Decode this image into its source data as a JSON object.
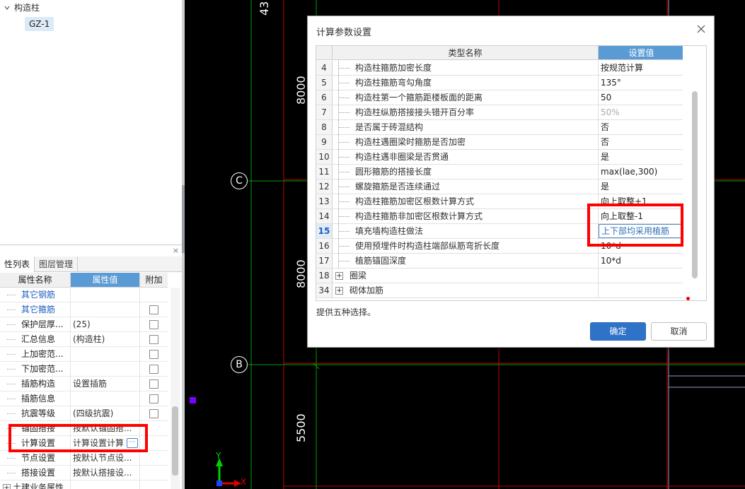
{
  "tree": {
    "root_label": "构造柱",
    "leaf_label": "GZ-1"
  },
  "prop_panel": {
    "close_glyph": "×",
    "tabs": [
      "性列表",
      "图层管理"
    ],
    "headers": {
      "name": "属性名称",
      "value": "属性值",
      "extra": "附加"
    },
    "rows": [
      {
        "name": "其它钢筋",
        "value": "",
        "blue": true,
        "checkbox": false
      },
      {
        "name": "其它箍筋",
        "value": "",
        "blue": true,
        "checkbox": true
      },
      {
        "name": "保护层厚...",
        "value": "(25)",
        "blue": false,
        "checkbox": true
      },
      {
        "name": "汇总信息",
        "value": "(构造柱)",
        "blue": false,
        "checkbox": true
      },
      {
        "name": "上加密范...",
        "value": "",
        "blue": false,
        "checkbox": true
      },
      {
        "name": "下加密范...",
        "value": "",
        "blue": false,
        "checkbox": true
      },
      {
        "name": "插筋构造",
        "value": "设置插筋",
        "blue": false,
        "checkbox": true
      },
      {
        "name": "插筋信息",
        "value": "",
        "blue": false,
        "checkbox": true
      },
      {
        "name": "抗震等级",
        "value": "(四级抗震)",
        "blue": false,
        "checkbox": true
      },
      {
        "name": "锚固搭接",
        "value": "按默认锚固搭...",
        "blue": false,
        "checkbox": false
      },
      {
        "name": "计算设置",
        "value": "计算设置计算",
        "blue": false,
        "checkbox": false,
        "ellipsis": true
      },
      {
        "name": "节点设置",
        "value": "按默认节点设...",
        "blue": false,
        "checkbox": false
      },
      {
        "name": "搭接设置",
        "value": "按默认搭接设...",
        "blue": false,
        "checkbox": false
      },
      {
        "name": "土建业务属性",
        "value": "",
        "blue": false,
        "checkbox": false,
        "group": true
      }
    ]
  },
  "canvas": {
    "dimensions": [
      "43",
      "8000",
      "8000",
      "5500"
    ],
    "axis_bubbles": [
      "C",
      "B"
    ],
    "ucs": {
      "y": "Y",
      "x": "X"
    }
  },
  "dialog": {
    "title": "计算参数设置",
    "columns": {
      "name": "类型名称",
      "value": "设置值"
    },
    "rows": [
      {
        "num": "4",
        "name": "构造柱箍筋加密长度",
        "value": "按规范计算"
      },
      {
        "num": "5",
        "name": "构造柱箍筋弯勾角度",
        "value": "135°"
      },
      {
        "num": "6",
        "name": "构造柱第一个箍筋距楼板面的距离",
        "value": "50"
      },
      {
        "num": "7",
        "name": "构造柱纵筋搭接接头错开百分率",
        "value": "50%",
        "gray": true
      },
      {
        "num": "8",
        "name": "是否属于砖混结构",
        "value": "否"
      },
      {
        "num": "9",
        "name": "构造柱遇圈梁时箍筋是否加密",
        "value": "否"
      },
      {
        "num": "10",
        "name": "构造柱遇非圈梁是否贯通",
        "value": "是"
      },
      {
        "num": "11",
        "name": "圆形箍筋的搭接长度",
        "value": "max(lae,300)"
      },
      {
        "num": "12",
        "name": "螺旋箍筋是否连续通过",
        "value": "是"
      },
      {
        "num": "13",
        "name": "构造柱箍筋加密区根数计算方式",
        "value": "向上取整+1"
      },
      {
        "num": "14",
        "name": "构造柱箍筋非加密区根数计算方式",
        "value": "向上取整-1"
      },
      {
        "num": "15",
        "name": "填充墙构造柱做法",
        "value": "上下部均采用植筋",
        "selected": true
      },
      {
        "num": "16",
        "name": "使用预埋件时构造柱端部纵筋弯折长度",
        "value": "10*d"
      },
      {
        "num": "17",
        "name": "植筋锚固深度",
        "value": "10*d"
      },
      {
        "num": "18",
        "name": "圈梁",
        "value": "",
        "group": true
      },
      {
        "num": "34",
        "name": "砌体加筋",
        "value": "",
        "group": true
      }
    ],
    "hint": "提供五种选择。",
    "ok_label": "确定",
    "cancel_label": "取消",
    "expander_glyph": "+"
  },
  "colors": {
    "accent": "#5b9bd5",
    "primary_button": "#2f73c9",
    "highlight_red": "#ff0000",
    "canvas_bg": "#000000",
    "grid_red": "#c00000",
    "grid_green": "#00a000"
  }
}
